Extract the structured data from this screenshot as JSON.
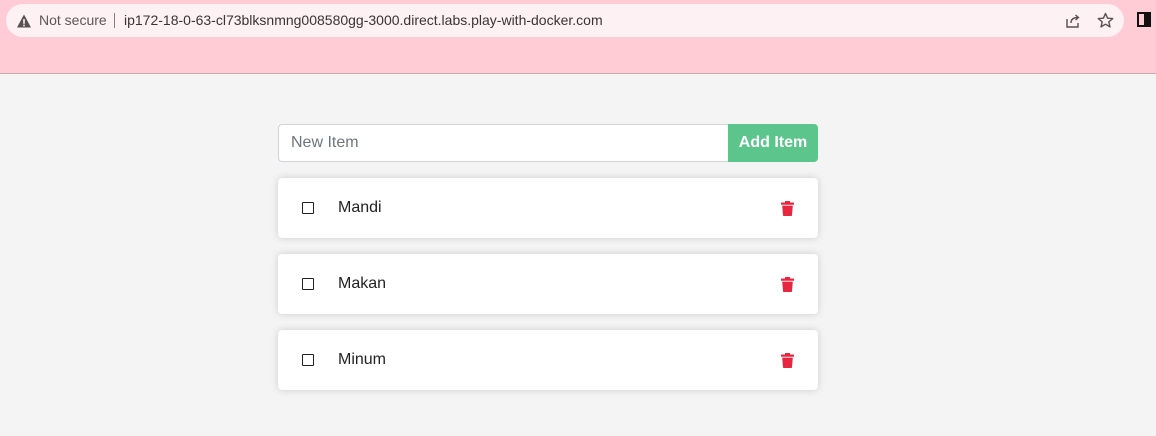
{
  "browser": {
    "security_label": "Not secure",
    "url": "ip172-18-0-63-cl73blksnmng008580gg-3000.direct.labs.play-with-docker.com"
  },
  "form": {
    "input_value": "",
    "input_placeholder": "New Item",
    "add_button_label": "Add Item",
    "add_button_color": "#5cc58b"
  },
  "items": [
    {
      "label": "Mandi",
      "completed": false
    },
    {
      "label": "Makan",
      "completed": false
    },
    {
      "label": "Minum",
      "completed": false
    }
  ],
  "colors": {
    "browser_bar": "#ffccd5",
    "page_background": "#f4f4f4",
    "delete_icon": "#e8253f"
  },
  "icons": {
    "warning": "warning-icon",
    "share": "share-icon",
    "bookmark": "star-icon",
    "side_panel": "side-panel-icon",
    "delete": "trash-icon"
  }
}
